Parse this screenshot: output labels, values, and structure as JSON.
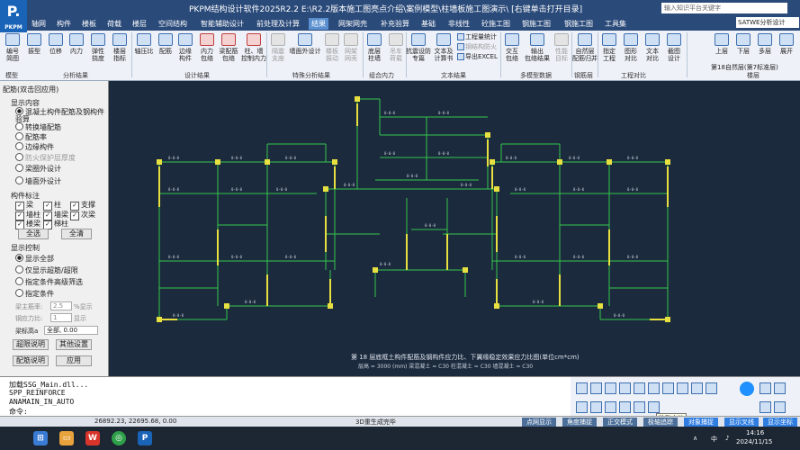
{
  "app": {
    "title": "PKPM结构设计软件2025R2.2  E:\\R2.2版本施工图亮点介绍\\案例模型\\柱墙板施工图演示\\ [右键单击打开目录]",
    "search_placeholder": "输入知识平台关键字",
    "logo_text": "P.",
    "logo_subtext": "PKPM"
  },
  "menu": {
    "tabs": [
      "轴网",
      "构件",
      "楼板",
      "荷载",
      "楼层",
      "空间结构",
      "智能辅助设计",
      "前处理及计算",
      "结果",
      "网架网壳",
      "补充验算",
      "基础",
      "非线性",
      "砼施工图",
      "钢施工图",
      "钢施工图",
      "工具集"
    ],
    "active_index": 8,
    "model_select": "SATWE分析设计"
  },
  "ribbon": {
    "buttons": [
      {
        "label": "编号\n简图",
        "icon": "numbering-diagram-icon"
      },
      {
        "label": "振型",
        "icon": "mode-shape-icon"
      },
      {
        "label": "位移",
        "icon": "displacement-icon"
      },
      {
        "label": "内力",
        "icon": "internal-force-icon"
      },
      {
        "label": "弹性\n挠度",
        "icon": "elastic-deflection-icon"
      },
      {
        "label": "楼层\n指标",
        "icon": "story-index-icon"
      },
      {
        "label": "轴压比",
        "icon": "axial-compression-icon"
      },
      {
        "label": "配筋",
        "icon": "reinforcement-icon"
      },
      {
        "label": "边缘\n构件",
        "icon": "boundary-member-icon"
      },
      {
        "label": "内力\n包络",
        "icon": "force-envelope-icon"
      },
      {
        "label": "梁配筋\n包络",
        "icon": "beam-reinf-envelope-icon"
      },
      {
        "label": "柱、墙\n控制内力",
        "icon": "column-wall-force-icon"
      },
      {
        "label": "隔震\n支座",
        "icon": "isolation-bearing-icon"
      },
      {
        "label": "墙面外设计",
        "icon": "wall-outplane-icon"
      },
      {
        "label": "楼板\n振动",
        "icon": "slab-vibration-icon"
      },
      {
        "label": "网架\n网壳",
        "icon": "space-grid-icon"
      },
      {
        "label": "底层\n柱墙",
        "icon": "bottom-column-wall-icon"
      },
      {
        "label": "吊车\n荷载",
        "icon": "crane-load-icon"
      },
      {
        "label": "抗震设防\n专篇",
        "icon": "seismic-report-icon"
      },
      {
        "label": "文本及\n计算书",
        "icon": "text-report-icon"
      },
      {
        "label": "交互\n包络",
        "icon": "interactive-envelope-icon"
      },
      {
        "label": "输出\n包络结果",
        "icon": "output-envelope-icon"
      },
      {
        "label": "性能\n目标",
        "icon": "performance-target-icon"
      },
      {
        "label": "自然层\n配筋归并",
        "icon": "natural-floor-merge-icon"
      },
      {
        "label": "指定\n工程",
        "icon": "assign-project-icon"
      },
      {
        "label": "图形\n对比",
        "icon": "graphic-compare-icon"
      },
      {
        "label": "文本\n对比",
        "icon": "text-compare-icon"
      },
      {
        "label": "截图\n设计",
        "icon": "screenshot-icon"
      },
      {
        "label": "上层",
        "icon": "up-floor-icon"
      },
      {
        "label": "下层",
        "icon": "down-floor-icon"
      },
      {
        "label": "多层",
        "icon": "multi-floor-icon"
      },
      {
        "label": "展开",
        "icon": "expand-icon"
      }
    ],
    "small_items": [
      "工程量统计",
      "钢结构防火",
      "导出EXCEL"
    ],
    "floor_label": "第18自然层(第7标准层)",
    "groups": [
      "模型",
      "分析结果",
      "设计结果",
      "特殊分析结果",
      "组合内力",
      "文本结果",
      "多模型数据",
      "钢筋层",
      "工程对比",
      "楼层"
    ]
  },
  "left_panel": {
    "title": "配筋(双击回应用)",
    "display_content": {
      "heading": "显示内容",
      "options": [
        "混凝土构件配筋及钢构件验算",
        "转换墙配筋",
        "配筋率",
        "边缘构件",
        "防火保护层厚度",
        "梁圈外设计",
        "墙面外设计"
      ],
      "selected_index": 0,
      "disabled_index": 4
    },
    "member_labels": {
      "heading": "构件标注",
      "checks": [
        "梁",
        "柱",
        "支撑",
        "墙柱",
        "墙梁",
        "次梁",
        "楼梁",
        "梯柱"
      ],
      "select_all": "全选",
      "clear_all": "全清"
    },
    "display_control": {
      "heading": "显示控制",
      "options": [
        "显示全部",
        "仅显示超筋/超限",
        "指定条件高级筛选",
        "指定条件"
      ],
      "selected_index": 0,
      "reinf_ratio_label": "梁主筋率:",
      "reinf_ratio_value": "2.5",
      "reinf_ratio_unit": "%显示",
      "stress_label": "钢应力比:",
      "stress_value": "1",
      "stress_unit": "显示",
      "beam_height_label": "梁标高a",
      "beam_height_value": "全部, 0.00",
      "btn_overlimit": "超限说明",
      "btn_other": "其他设置",
      "btn_reinf_desc": "配筋说明",
      "btn_apply": "应用"
    }
  },
  "drawing": {
    "caption": "第 18 层底框土构件配筋及钢构件应力比、下翼缘稳定效果应力比图(单位cm*cm)",
    "caption_sub": "层高 = 3000 (mm)  梁混凝土 = C30   柱混凝土 = C30   墙混凝土 = C30"
  },
  "command": {
    "lines": [
      "加载SSG_Main.dll...",
      "SPP_REINFORCE",
      "ANAMAIN_IN_AUTO"
    ],
    "prompt": "命令:"
  },
  "status": {
    "coordinates": "26892.23, 22695.68, 0.00",
    "message": "3D重生成完毕",
    "buttons": [
      "点网显示",
      "角度捕捉",
      "正交模式",
      "极轴追踪",
      "对象捕捉",
      "显示叉线",
      "显示坐标"
    ],
    "on_indices": [
      4,
      5,
      6
    ],
    "tooltip": "移动字符"
  },
  "taskbar": {
    "time": "14:16",
    "date": "2024/11/15",
    "lang": "中"
  },
  "colors": {
    "menubar": "#2a4a7a",
    "active_tab": "#5a8fd0",
    "canvas": "#1b2a3d",
    "beam_green": "#35c64a",
    "column_yellow": "#e8e040",
    "text_white": "#e0e6f0"
  }
}
